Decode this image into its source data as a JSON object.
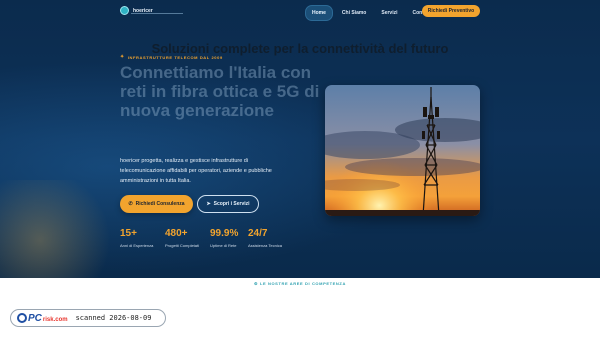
{
  "brand": {
    "name": "hoericer"
  },
  "nav": {
    "items": [
      "Home",
      "Chi Siamo",
      "Servizi",
      "Contatti"
    ],
    "active": "Home",
    "cta": "Richiedi Preventivo"
  },
  "hero": {
    "eyebrow": "INFRASTRUTTURE TELECOM DAL 2009",
    "title": "Connettiamo l'Italia con reti in fibra ottica e 5G di nuova generazione",
    "description": "hoericer progetta, realizza e gestisce infrastrutture di telecomunicazione affidabili per operatori, aziende e pubbliche amministrazioni in tutta Italia.",
    "primary_button": "Richiedi Consulenza",
    "secondary_button": "Scopri i Servizi",
    "stats": [
      {
        "value": "15+",
        "label": "Anni di Esperienza"
      },
      {
        "value": "480+",
        "label": "Progetti Completati"
      },
      {
        "value": "99.9%",
        "label": "Uptime di Rete"
      },
      {
        "value": "24/7",
        "label": "Assistenza Tecnica"
      }
    ]
  },
  "section": {
    "eyebrow": "LE NOSTRE AREE DI COMPETENZA",
    "title": "Soluzioni complete per la connettività del futuro"
  },
  "badge": {
    "logo_text_pc": "PC",
    "logo_text_risk": "risk.com",
    "text": "scanned 2026-08-09"
  },
  "colors": {
    "accent": "#f2a42e",
    "teal": "#2fa1b0",
    "navy": "#0b2b4d"
  }
}
